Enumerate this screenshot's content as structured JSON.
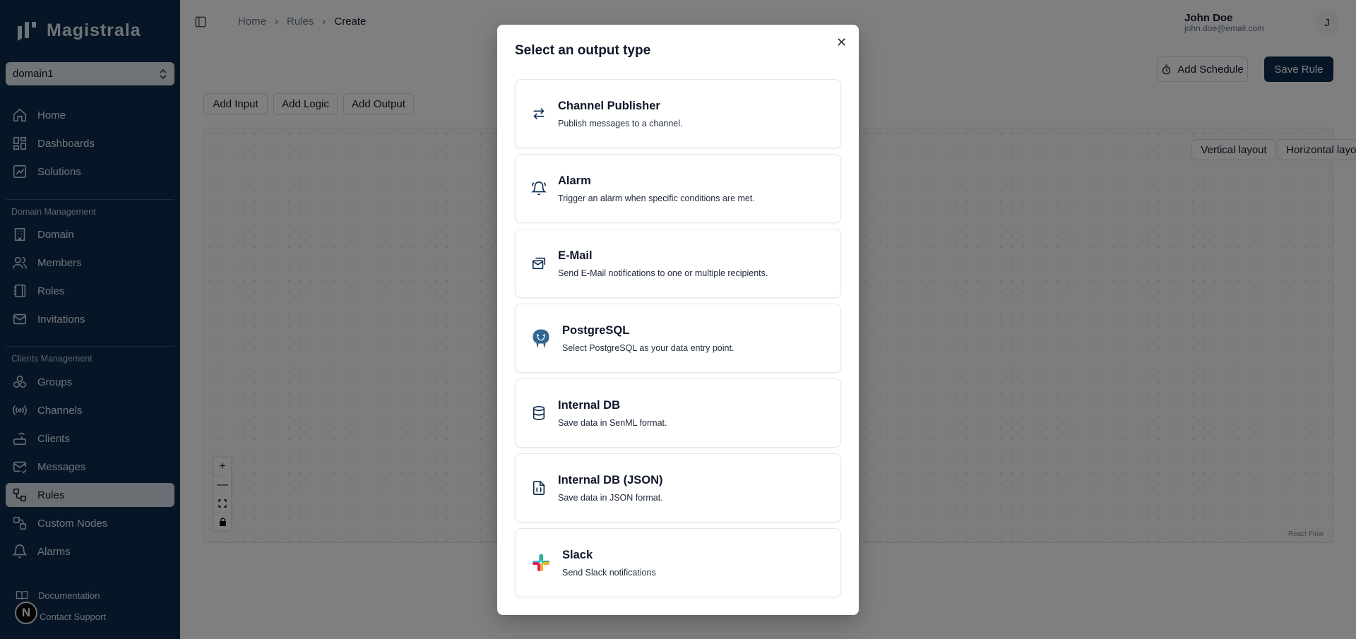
{
  "app": {
    "name": "Magistrala"
  },
  "domain_selector": {
    "value": "domain1"
  },
  "sidebar": {
    "main_items": [
      {
        "label": "Home",
        "icon": "home-icon"
      },
      {
        "label": "Dashboards",
        "icon": "dashboard-icon"
      },
      {
        "label": "Solutions",
        "icon": "solutions-icon"
      }
    ],
    "domain_section": {
      "label": "Domain Management",
      "items": [
        {
          "label": "Domain",
          "icon": "building-icon"
        },
        {
          "label": "Members",
          "icon": "users-icon"
        },
        {
          "label": "Roles",
          "icon": "notebook-icon"
        },
        {
          "label": "Invitations",
          "icon": "mail-icon"
        }
      ]
    },
    "clients_section": {
      "label": "Clients Management",
      "items": [
        {
          "label": "Groups",
          "icon": "groups-icon"
        },
        {
          "label": "Channels",
          "icon": "radio-icon"
        },
        {
          "label": "Clients",
          "icon": "router-icon"
        },
        {
          "label": "Messages",
          "icon": "mail-check-icon"
        },
        {
          "label": "Rules",
          "icon": "rules-icon",
          "active": true
        },
        {
          "label": "Custom Nodes",
          "icon": "custom-nodes-icon"
        },
        {
          "label": "Alarms",
          "icon": "bell-icon"
        }
      ]
    },
    "footer": {
      "documentation": "Documentation",
      "contact_support": "Contact Support",
      "badge": "N"
    }
  },
  "breadcrumb": {
    "items": [
      "Home",
      "Rules",
      "Create"
    ]
  },
  "user": {
    "name": "John Doe",
    "email": "john.doe@email.com",
    "initial": "J"
  },
  "toolbar": {
    "add_schedule": "Add Schedule",
    "save_rule": "Save Rule",
    "add_input": "Add Input",
    "add_logic": "Add Logic",
    "add_output": "Add Output",
    "vertical_layout": "Vertical layout",
    "horizontal_layout": "Horizontal layout"
  },
  "canvas": {
    "zoom_in": "+",
    "zoom_out": "—",
    "attribution": "React Flow"
  },
  "modal": {
    "title": "Select an output type",
    "close": "✕",
    "options": [
      {
        "title": "Channel Publisher",
        "description": "Publish messages to a channel.",
        "icon": "arrows-swap-icon"
      },
      {
        "title": "Alarm",
        "description": "Trigger an alarm when specific conditions are met.",
        "icon": "bell-ring-icon"
      },
      {
        "title": "E-Mail",
        "description": "Send E-Mail notifications to one or multiple recipients.",
        "icon": "mail-open-icon"
      },
      {
        "title": "PostgreSQL",
        "description": "Select PostgreSQL as your data entry point.",
        "icon": "postgresql-logo-icon"
      },
      {
        "title": "Internal DB",
        "description": "Save data in SenML format.",
        "icon": "database-icon"
      },
      {
        "title": "Internal DB (JSON)",
        "description": "Save data in JSON format.",
        "icon": "file-json-icon"
      },
      {
        "title": "Slack",
        "description": "Send Slack notifications",
        "icon": "slack-logo-icon"
      }
    ]
  }
}
